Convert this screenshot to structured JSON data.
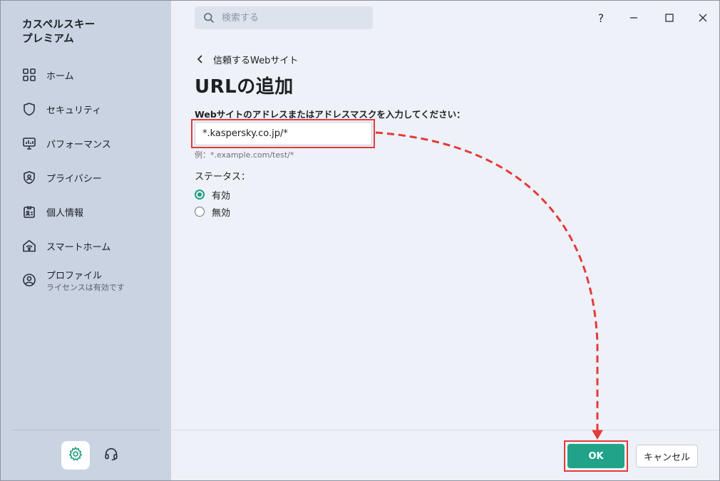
{
  "app": {
    "title_line1": "カスペルスキー",
    "title_line2": "プレミアム"
  },
  "sidebar": {
    "items": [
      {
        "label": "ホーム",
        "icon": "home-grid-icon"
      },
      {
        "label": "セキュリティ",
        "icon": "shield-icon"
      },
      {
        "label": "パフォーマンス",
        "icon": "monitor-icon"
      },
      {
        "label": "プライバシー",
        "icon": "privacy-shield-icon"
      },
      {
        "label": "個人情報",
        "icon": "id-card-icon"
      },
      {
        "label": "スマートホーム",
        "icon": "wifi-home-icon"
      },
      {
        "label": "プロファイル",
        "sublabel": "ライセンスは有効です",
        "icon": "profile-icon"
      }
    ],
    "footer_icons": [
      "gear-icon",
      "headset-icon"
    ]
  },
  "search": {
    "placeholder": "検索する"
  },
  "window_controls": {
    "help": "?"
  },
  "breadcrumb": {
    "label": "信頼するWebサイト"
  },
  "page": {
    "title": "URLの追加"
  },
  "form": {
    "field_label": "Webサイトのアドレスまたはアドレスマスクを入力してください：",
    "url_value": "*.kaspersky.co.jp/*",
    "hint": "例：*.example.com/test/*",
    "status_label": "ステータス：",
    "options": [
      {
        "label": "有効",
        "selected": true
      },
      {
        "label": "無効",
        "selected": false
      }
    ]
  },
  "buttons": {
    "ok": "OK",
    "cancel": "キャンセル"
  },
  "colors": {
    "accent": "#21a38a",
    "annotation": "#e23b3b",
    "sidebar": "#c9d3e2",
    "content": "#eef1f7"
  }
}
